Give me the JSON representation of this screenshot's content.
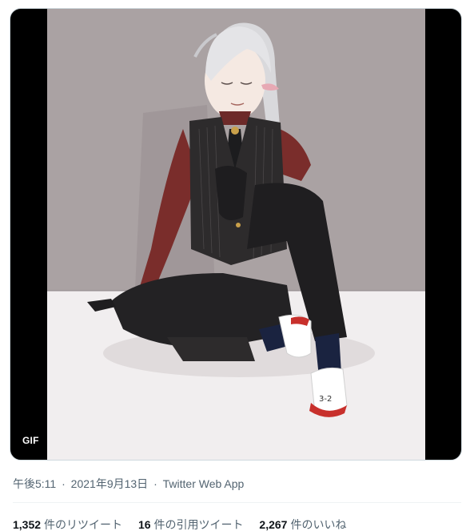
{
  "media": {
    "badge": "GIF",
    "alt_icon": "animated-illustration"
  },
  "meta": {
    "time": "午後5:11",
    "date": "2021年9月13日",
    "separator": "·",
    "source": "Twitter Web App"
  },
  "stats": [
    {
      "count": "1,352",
      "label": "件のリツイート"
    },
    {
      "count": "16",
      "label": "件の引用ツイート"
    },
    {
      "count": "2,267",
      "label": "件のいいね"
    }
  ],
  "colors": {
    "muted_text": "#536471",
    "primary_text": "#0f1419",
    "wall": "#a89f9f",
    "floor": "#f1eeef",
    "shirt": "#7a2d2b"
  }
}
